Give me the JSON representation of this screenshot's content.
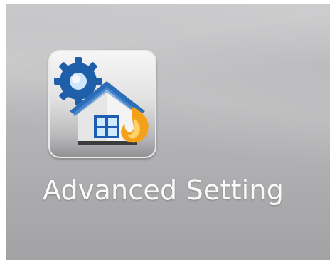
{
  "desktop": {
    "shortcut": {
      "label": "Advanced Setting",
      "icon": "house-gear-flame-icon"
    }
  },
  "colors": {
    "background": "#b6b6b8",
    "label_text": "#fafafa",
    "gear": "#1f5ea8",
    "roof": "#2b6db8",
    "flame": "#f3a11a"
  }
}
